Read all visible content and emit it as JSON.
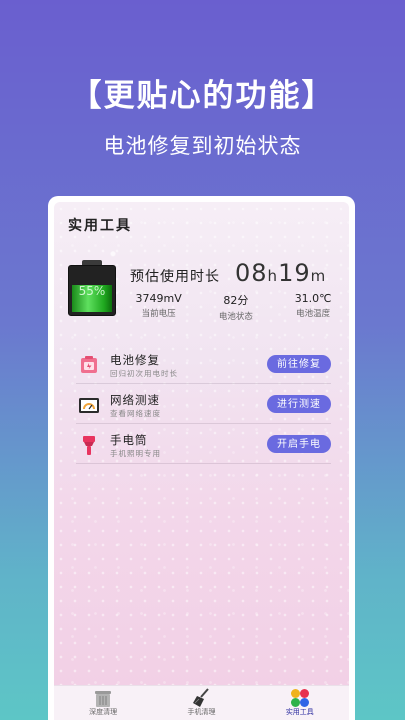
{
  "promo": {
    "headline": "【更贴心的功能】",
    "subline": "电池修复到初始状态"
  },
  "header": {
    "title": "实用工具"
  },
  "battery": {
    "percent": "55%",
    "level": 0.55,
    "estimate_label": "预估使用时长",
    "estimate_hours": "08",
    "estimate_h_unit": "h",
    "estimate_minutes": "19",
    "estimate_m_unit": "m",
    "stats": [
      {
        "value": "3749mV",
        "label": "当前电压"
      },
      {
        "value": "82分",
        "label": "电池状态"
      },
      {
        "value": "31.0℃",
        "label": "电池温度"
      }
    ]
  },
  "tools": [
    {
      "title": "电池修复",
      "desc": "回归初次用电时长",
      "button": "前往修复",
      "icon": "battery-repair-icon"
    },
    {
      "title": "网络测速",
      "desc": "查看网络速度",
      "button": "进行测速",
      "icon": "speedometer-icon"
    },
    {
      "title": "手电筒",
      "desc": "手机照明专用",
      "button": "开启手电",
      "icon": "flashlight-icon"
    }
  ],
  "tabbar": [
    {
      "label": "深度清理",
      "icon": "trash-can-icon"
    },
    {
      "label": "手机清理",
      "icon": "broom-icon"
    },
    {
      "label": "实用工具",
      "icon": "apps-grid-icon",
      "active": true
    }
  ],
  "colors": {
    "accent_button": "#6a6ae0",
    "value_blue": "#1d3aa8",
    "bg_top": "#6a5fcf",
    "bg_bottom": "#5dc6c6"
  }
}
